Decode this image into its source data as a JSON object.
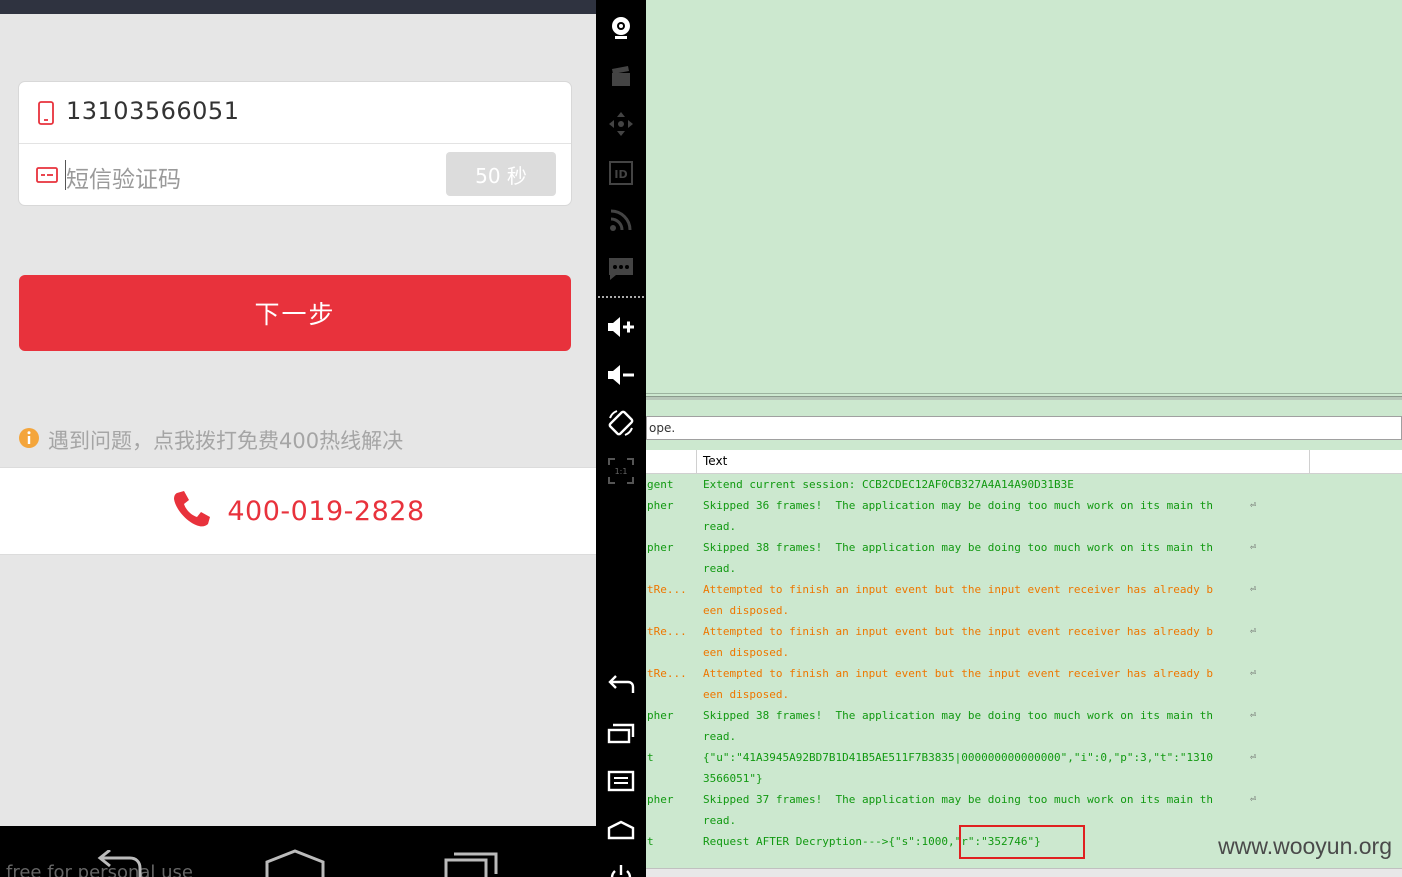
{
  "phone": {
    "phone_number": "13103566051",
    "sms_code_placeholder": "短信验证码",
    "countdown_label": "50 秒",
    "next_button_label": "下一步",
    "help_text": "遇到问题，点我拨打免费400热线解决",
    "hotline_number": "400-019-2828",
    "behind_text": "free for personal use",
    "accent_color": "#e8323c"
  },
  "sidebar": {
    "icons": [
      "camera-icon",
      "video-clip-icon",
      "dpad-icon",
      "device-id-icon",
      "rss-icon",
      "sms-icon",
      "volume-up-icon",
      "volume-down-icon",
      "rotate-icon",
      "scale-1-1-icon",
      "back-icon",
      "recent-apps-icon",
      "menu-icon",
      "home-icon",
      "power-icon"
    ],
    "scale_label": "1:1"
  },
  "logcat": {
    "filter_text": "ope.",
    "text_column_header": "Text",
    "rows": [
      {
        "level": "info",
        "tag": "gent",
        "lines": [
          "Extend current session: CCB2CDEC12AF0CB327A4A14A90D31B3E"
        ]
      },
      {
        "level": "info",
        "tag": "pher",
        "lines": [
          "Skipped 36 frames!  The application may be doing too much work on its main th",
          "read."
        ]
      },
      {
        "level": "info",
        "tag": "pher",
        "lines": [
          "Skipped 38 frames!  The application may be doing too much work on its main th",
          "read."
        ]
      },
      {
        "level": "warn",
        "tag": "tRe...",
        "lines": [
          "Attempted to finish an input event but the input event receiver has already b",
          "een disposed."
        ]
      },
      {
        "level": "warn",
        "tag": "tRe...",
        "lines": [
          "Attempted to finish an input event but the input event receiver has already b",
          "een disposed."
        ]
      },
      {
        "level": "warn",
        "tag": "tRe...",
        "lines": [
          "Attempted to finish an input event but the input event receiver has already b",
          "een disposed."
        ]
      },
      {
        "level": "info",
        "tag": "pher",
        "lines": [
          "Skipped 38 frames!  The application may be doing too much work on its main th",
          "read."
        ]
      },
      {
        "level": "info",
        "tag": "t",
        "lines": [
          "{\"u\":\"41A3945A92BD7B1D41B5AE511F7B3835|000000000000000\",\"i\":0,\"p\":3,\"t\":\"1310",
          "3566051\"}"
        ]
      },
      {
        "level": "info",
        "tag": "pher",
        "lines": [
          "Skipped 37 frames!  The application may be doing too much work on its main th",
          "read."
        ]
      },
      {
        "level": "info",
        "tag": "t",
        "lines": [
          "Request AFTER Decryption--->{\"s\":1000,\"r\":\"352746\"}"
        ]
      }
    ],
    "wrap_symbol": "⏎",
    "info_color": "#119911",
    "warn_color": "#ee7700",
    "highlight_color": "#e02020"
  },
  "watermark": "www.wooyun.org"
}
